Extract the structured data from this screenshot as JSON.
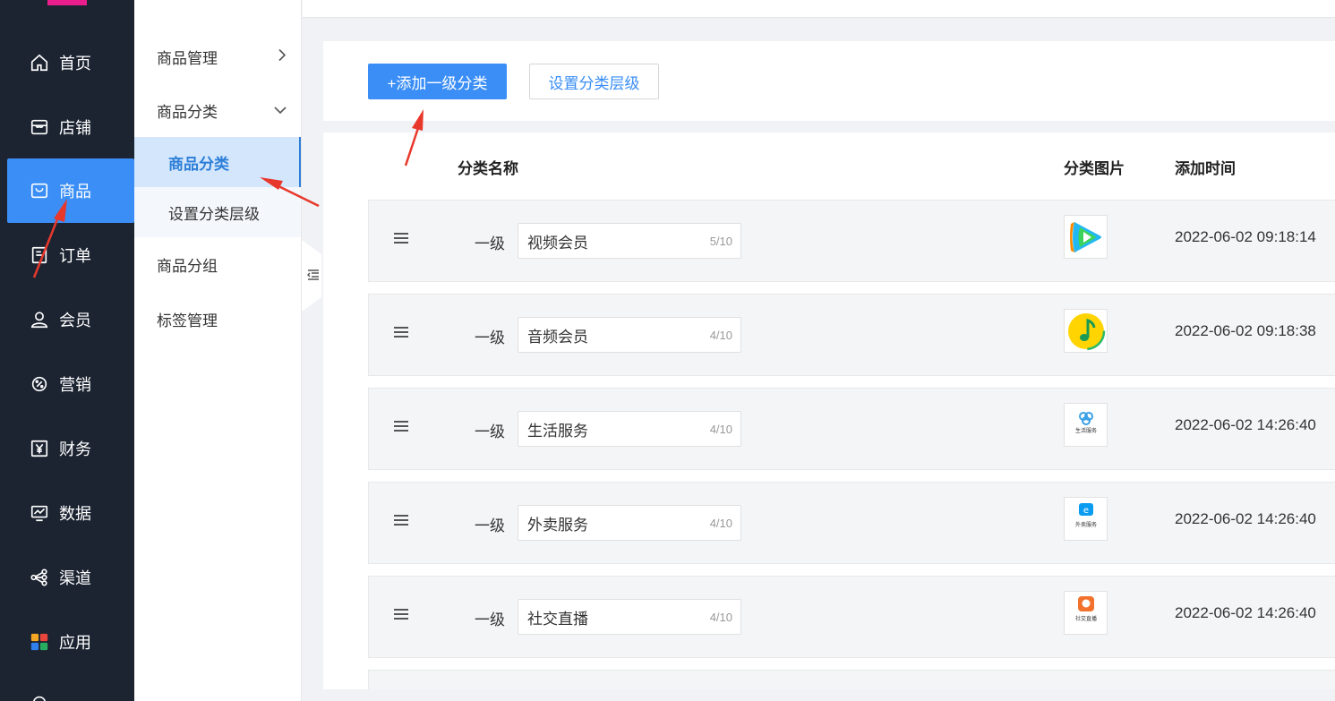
{
  "sidebar": {
    "items": [
      {
        "label": "首页",
        "icon": "home-icon"
      },
      {
        "label": "店铺",
        "icon": "store-icon"
      },
      {
        "label": "商品",
        "icon": "bag-icon",
        "active": true
      },
      {
        "label": "订单",
        "icon": "order-icon"
      },
      {
        "label": "会员",
        "icon": "user-icon"
      },
      {
        "label": "营销",
        "icon": "marketing-icon"
      },
      {
        "label": "财务",
        "icon": "yen-icon"
      },
      {
        "label": "数据",
        "icon": "chart-icon"
      },
      {
        "label": "渠道",
        "icon": "channel-icon"
      },
      {
        "label": "应用",
        "icon": "apps-icon"
      }
    ],
    "accent": "#3a8ef6",
    "logo_color": "#e91e8c"
  },
  "submenu": {
    "product_manage": "商品管理",
    "product_category": "商品分类",
    "child_category": "商品分类",
    "child_level": "设置分类层级",
    "product_group": "商品分组",
    "tag_manage": "标签管理"
  },
  "toolbar": {
    "add_label": "+添加一级分类",
    "level_label": "设置分类层级"
  },
  "table": {
    "headers": {
      "name": "分类名称",
      "image": "分类图片",
      "time": "添加时间"
    },
    "rows": [
      {
        "level": "一级",
        "name": "视频会员",
        "count": "5/10",
        "image": "video-app-icon",
        "time": "2022-06-02 09:18:14"
      },
      {
        "level": "一级",
        "name": "音频会员",
        "count": "4/10",
        "image": "music-app-icon",
        "time": "2022-06-02 09:18:38"
      },
      {
        "level": "一级",
        "name": "生活服务",
        "count": "4/10",
        "image": "life-service-icon",
        "image_text": "生活服务",
        "time": "2022-06-02 14:26:40"
      },
      {
        "level": "一级",
        "name": "外卖服务",
        "count": "4/10",
        "image": "delivery-service-icon",
        "image_text": "外卖服务",
        "time": "2022-06-02 14:26:40"
      },
      {
        "level": "一级",
        "name": "社交直播",
        "count": "4/10",
        "image": "social-live-icon",
        "image_text": "社交直播",
        "time": "2022-06-02 14:26:40"
      }
    ]
  }
}
